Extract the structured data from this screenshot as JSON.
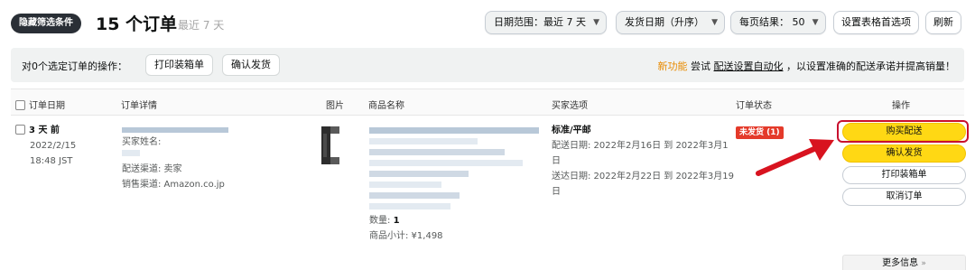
{
  "header": {
    "filter_pill": "隐藏筛选条件",
    "order_count": "15 个订单",
    "date_hint": "最近 7 天",
    "date_range": "日期范围：最近 7 天",
    "sort": "发货日期（升序）",
    "per_page": "每页结果： 50",
    "table_settings": "设置表格首选项",
    "refresh": "刷新"
  },
  "action_bar": {
    "label": "对0个选定订单的操作：",
    "print_packing": "打印装箱单",
    "confirm_ship": "确认发货",
    "promo_new": "新功能",
    "promo_pre": "尝试",
    "promo_link": "配送设置自动化",
    "promo_post": "，以设置准确的配送承诺并提高销量！"
  },
  "table": {
    "columns": [
      "订单日期",
      "订单详情",
      "图片",
      "商品名称",
      "买家选项",
      "订单状态",
      "操作"
    ]
  },
  "order": {
    "age": "3 天 前",
    "date": "2022/2/15",
    "time": "18:48 JST",
    "buyer_name_label": "买家姓名:",
    "channel": "配送渠道: 卖家",
    "sales_channel": "销售渠道: Amazon.co.jp",
    "quantity_label": "数量:",
    "quantity": "1",
    "subtotal": "商品小计: ¥1,498",
    "ship_option": "标准/平邮",
    "ship_date_line1": "配送日期: 2022年2月16日 到 2022年3月1",
    "ship_date_line2": "日",
    "delivery_line1": "送达日期: 2022年2月22日 到 2022年3月19",
    "delivery_line2": "日",
    "status": "未发货 (1)",
    "actions": {
      "buy_shipping": "购买配送",
      "confirm_ship": "确认发货",
      "print_packing": "打印装箱单",
      "cancel_order": "取消订单"
    },
    "more_info": "更多信息",
    "more_info_chevron": "»"
  },
  "colors": {
    "accent_yellow": "#ffd814",
    "status_red": "#e43a2a",
    "highlight_red": "#c8102e",
    "promo_orange": "#e88b00",
    "pill_dark": "#2a2f36"
  }
}
